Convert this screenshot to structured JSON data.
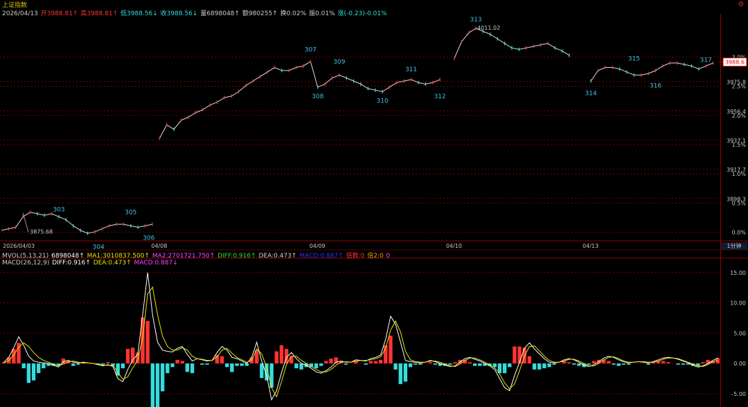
{
  "header": {
    "index_name": "上证指数",
    "date": "2026/04/13",
    "open": "开3988.81↑",
    "high": "高3988.81↑",
    "low": "低3988.56↓",
    "close": "收3988.56↓",
    "volume": "量6898048↑",
    "amount": "额980255↑",
    "turnover": "换0.02%",
    "amplitude": "振0.01%",
    "change": "涨(-0.23)-0.01%"
  },
  "mvol_line": {
    "label": "MVOL(5,13,21)",
    "vol": "6898048↑",
    "ma1": "MA1:3010837.500↑",
    "ma2": "MA2:2701721.750↑",
    "diff": "DIFF:0.916↑",
    "dea": "DEA:0.473↑",
    "macd_hidden": "MACD:0.887↑",
    "dir": "倍数:0",
    "dir2": "倍2:0",
    "zero": "0"
  },
  "macd_line": {
    "label": "MACD(26,12,9)",
    "diff": "DIFF:0.916↑",
    "dea": "DEA:0.473↑",
    "macd": "MACD:0.887↓"
  },
  "colors": {
    "up": "#ff3333",
    "down": "#33dddd",
    "grid": "#7a0000",
    "label_blue": "#3fc0e8",
    "axis_text": "#c8c8c8",
    "yellow": "#e8e800",
    "white": "#ffffff"
  },
  "current_price_tag": "3988.6",
  "time_unit_tag": "1分钟",
  "icons": {
    "settings": "gear-icon"
  },
  "chart_data": [
    {
      "type": "line",
      "name": "price",
      "x_labels": [
        "2026/04/03",
        "04/08",
        "04/09",
        "04/10",
        "04/13"
      ],
      "price_axis_ticks": [
        "3898.3",
        "3917.7",
        "3937.1",
        "3956.4",
        "3975.8",
        "3988.6"
      ],
      "percent_axis_ticks": [
        "0.0%",
        "0.5%",
        "1.0%",
        "1.5%",
        "2.0%",
        "2.5%",
        "3.0%"
      ],
      "annotations": [
        {
          "label": "303",
          "value": 3885
        },
        {
          "label": "304",
          "value": 3872
        },
        {
          "label": "305",
          "value": 3883
        },
        {
          "label": "306",
          "value": 3878
        },
        {
          "label": "307",
          "value": 3991
        },
        {
          "label": "308",
          "value": 3972
        },
        {
          "label": "309",
          "value": 3983
        },
        {
          "label": "310",
          "value": 3969
        },
        {
          "label": "311",
          "value": 3978
        },
        {
          "label": "312",
          "value": 3972
        },
        {
          "label": "313",
          "value": 4011
        },
        {
          "label": "314",
          "value": 3974
        },
        {
          "label": "315",
          "value": 3985
        },
        {
          "label": "316",
          "value": 3979
        },
        {
          "label": "317",
          "value": 3984
        }
      ],
      "price_labels": [
        {
          "label": "3875.68",
          "value": 3875.68
        },
        {
          "label": "4011.02",
          "value": 4011.02
        }
      ],
      "points": [
        [
          0,
          3877
        ],
        [
          2,
          3878
        ],
        [
          4,
          3879
        ],
        [
          6,
          3886
        ],
        [
          8,
          3889
        ],
        [
          10,
          3888
        ],
        [
          12,
          3887
        ],
        [
          14,
          3888
        ],
        [
          16,
          3886
        ],
        [
          18,
          3884
        ],
        [
          20,
          3880
        ],
        [
          22,
          3877
        ],
        [
          24,
          3875
        ],
        [
          26,
          3876
        ],
        [
          28,
          3878
        ],
        [
          30,
          3880
        ],
        [
          32,
          3881
        ],
        [
          34,
          3881
        ],
        [
          36,
          3880
        ],
        [
          38,
          3879
        ],
        [
          40,
          3880
        ],
        [
          42,
          3881
        ],
        [
          44,
          3938
        ],
        [
          46,
          3947
        ],
        [
          48,
          3944
        ],
        [
          50,
          3950
        ],
        [
          52,
          3952
        ],
        [
          54,
          3955
        ],
        [
          56,
          3957
        ],
        [
          58,
          3960
        ],
        [
          60,
          3962
        ],
        [
          62,
          3965
        ],
        [
          64,
          3966
        ],
        [
          66,
          3969
        ],
        [
          68,
          3973
        ],
        [
          70,
          3976
        ],
        [
          72,
          3979
        ],
        [
          74,
          3982
        ],
        [
          76,
          3985
        ],
        [
          78,
          3983
        ],
        [
          80,
          3983
        ],
        [
          82,
          3985
        ],
        [
          84,
          3986
        ],
        [
          86,
          3989
        ],
        [
          88,
          3972
        ],
        [
          90,
          3974
        ],
        [
          92,
          3978
        ],
        [
          94,
          3980
        ],
        [
          96,
          3978
        ],
        [
          98,
          3976
        ],
        [
          100,
          3974
        ],
        [
          102,
          3971
        ],
        [
          104,
          3970
        ],
        [
          106,
          3969
        ],
        [
          108,
          3972
        ],
        [
          110,
          3975
        ],
        [
          112,
          3976
        ],
        [
          114,
          3977
        ],
        [
          116,
          3975
        ],
        [
          118,
          3974
        ],
        [
          120,
          3975
        ],
        [
          122,
          3977
        ],
        [
          126,
          3991
        ],
        [
          128,
          4002
        ],
        [
          130,
          4008
        ],
        [
          132,
          4011
        ],
        [
          134,
          4009
        ],
        [
          136,
          4007
        ],
        [
          138,
          4004
        ],
        [
          140,
          4001
        ],
        [
          142,
          3998
        ],
        [
          144,
          3997
        ],
        [
          146,
          3998
        ],
        [
          148,
          3999
        ],
        [
          150,
          4000
        ],
        [
          152,
          4001
        ],
        [
          154,
          3998
        ],
        [
          156,
          3996
        ],
        [
          158,
          3993
        ],
        [
          164,
          3976
        ],
        [
          166,
          3983
        ],
        [
          168,
          3985
        ],
        [
          170,
          3985
        ],
        [
          172,
          3984
        ],
        [
          174,
          3982
        ],
        [
          176,
          3980
        ],
        [
          178,
          3980
        ],
        [
          180,
          3981
        ],
        [
          182,
          3983
        ],
        [
          184,
          3986
        ],
        [
          186,
          3988
        ],
        [
          188,
          3988
        ],
        [
          190,
          3987
        ],
        [
          192,
          3986
        ],
        [
          194,
          3984
        ],
        [
          196,
          3986
        ],
        [
          198,
          3988
        ]
      ]
    },
    {
      "type": "bar",
      "name": "MACD",
      "ylim": [
        -6.5,
        16
      ],
      "y_ticks": [
        "15.00",
        "10.00",
        "5.00",
        "0.00",
        "-5.00"
      ],
      "series": [
        {
          "name": "DIFF",
          "values": [
            0.2,
            1.0,
            2.6,
            4.4,
            3.0,
            1.2,
            0.4,
            0.2,
            0.1,
            0.0,
            -0.3,
            -0.6,
            0.3,
            0.5,
            0.2,
            0.1,
            0.2,
            0.1,
            0.0,
            -0.2,
            -0.4,
            -0.2,
            -0.5,
            -2.5,
            -3.0,
            -1.0,
            0.6,
            1.5,
            8.0,
            15.0,
            8.0,
            3.5,
            2.2,
            2.0,
            1.9,
            2.5,
            2.8,
            1.5,
            0.4,
            0.8,
            0.6,
            0.4,
            0.5,
            1.8,
            2.8,
            2.2,
            1.0,
            0.8,
            0.4,
            0.0,
            1.0,
            3.5,
            0.4,
            -2.0,
            -6.0,
            -4.5,
            -1.5,
            1.0,
            1.8,
            0.8,
            0.0,
            -0.3,
            -0.8,
            -1.4,
            -1.6,
            -1.2,
            -0.6,
            0.2,
            0.4,
            0.2,
            0.2,
            0.6,
            0.5,
            0.4,
            0.8,
            1.0,
            1.4,
            4.0,
            7.8,
            6.5,
            3.5,
            0.5,
            0.3,
            0.2,
            0.1,
            0.2,
            0.5,
            0.3,
            0.0,
            -0.3,
            -0.5,
            -0.4,
            0.2,
            0.8,
            1.0,
            0.7,
            0.4,
            0.0,
            -0.4,
            -1.0,
            -2.5,
            -4.0,
            -4.5,
            -2.0,
            0.2,
            2.5,
            3.4,
            2.4,
            1.6,
            0.8,
            0.2,
            0.1,
            0.2,
            0.6,
            0.8,
            0.6,
            0.2,
            -0.3,
            -0.5,
            -0.2,
            0.3,
            0.9,
            1.2,
            1.0,
            0.6,
            0.3,
            0.1,
            0.2,
            0.3,
            0.2,
            0.1,
            0.3,
            0.6,
            0.9,
            1.0,
            0.9,
            0.7,
            0.4,
            0.1,
            -0.3,
            -0.6,
            -0.4,
            0.0,
            0.5,
            0.9
          ]
        },
        {
          "name": "DEA",
          "values": [
            0.1,
            0.5,
            1.4,
            2.7,
            3.4,
            2.8,
            1.8,
            1.0,
            0.5,
            0.2,
            -0.1,
            -0.4,
            -0.1,
            0.3,
            0.4,
            0.2,
            0.1,
            0.1,
            0.0,
            -0.1,
            -0.3,
            -0.3,
            -0.3,
            -1.5,
            -2.6,
            -2.2,
            -0.7,
            0.6,
            4.2,
            11.5,
            12.6,
            8.0,
            4.5,
            2.8,
            2.2,
            2.2,
            2.6,
            2.2,
            1.2,
            0.8,
            0.7,
            0.5,
            0.5,
            1.1,
            2.2,
            2.5,
            1.7,
            1.0,
            0.6,
            0.2,
            0.5,
            2.4,
            1.6,
            -0.6,
            -4.0,
            -5.5,
            -3.0,
            -0.2,
            1.2,
            1.2,
            0.5,
            0.0,
            -0.5,
            -1.0,
            -1.4,
            -1.4,
            -1.0,
            -0.3,
            0.2,
            0.3,
            0.2,
            0.4,
            0.5,
            0.5,
            0.6,
            0.8,
            1.1,
            2.5,
            5.5,
            7.0,
            5.2,
            2.0,
            0.6,
            0.3,
            0.2,
            0.2,
            0.4,
            0.4,
            0.2,
            -0.1,
            -0.4,
            -0.5,
            -0.1,
            0.5,
            0.9,
            0.9,
            0.6,
            0.2,
            -0.2,
            -0.7,
            -1.7,
            -3.2,
            -4.2,
            -3.4,
            -1.2,
            1.2,
            2.8,
            2.9,
            2.1,
            1.2,
            0.5,
            0.2,
            0.2,
            0.4,
            0.7,
            0.7,
            0.4,
            0.0,
            -0.4,
            -0.4,
            0.0,
            0.6,
            1.0,
            1.1,
            0.8,
            0.4,
            0.2,
            0.2,
            0.3,
            0.3,
            0.2,
            0.2,
            0.4,
            0.7,
            0.9,
            0.9,
            0.8,
            0.5,
            0.2,
            -0.1,
            -0.4,
            -0.5,
            -0.2,
            0.3,
            0.5
          ]
        },
        {
          "name": "MACD",
          "values": [
            0.2,
            1.0,
            2.4,
            3.4,
            -0.8,
            -3.2,
            -2.8,
            -1.6,
            -0.8,
            -0.4,
            -0.4,
            -0.4,
            0.8,
            0.4,
            -0.4,
            -0.2,
            0.2,
            0.0,
            0.0,
            -0.2,
            -0.2,
            0.2,
            -0.4,
            -2.0,
            -0.8,
            2.4,
            2.6,
            1.8,
            7.6,
            7.0,
            -9.2,
            -9.0,
            -4.6,
            -1.6,
            -0.6,
            0.6,
            0.4,
            -1.4,
            -1.6,
            0.0,
            -0.2,
            -0.2,
            0.0,
            1.4,
            1.2,
            -0.6,
            -1.4,
            -0.4,
            -0.4,
            -0.4,
            1.0,
            2.2,
            -2.4,
            -2.8,
            -4.0,
            2.0,
            3.0,
            2.4,
            1.2,
            -0.8,
            -1.0,
            -0.6,
            -0.6,
            -0.8,
            -0.4,
            0.4,
            0.8,
            1.0,
            0.4,
            -0.2,
            0.0,
            0.4,
            0.0,
            -0.2,
            0.4,
            0.4,
            0.6,
            3.0,
            4.6,
            -1.0,
            -3.4,
            -3.0,
            -0.6,
            -0.2,
            -0.2,
            0.0,
            0.2,
            -0.2,
            -0.4,
            -0.4,
            -0.2,
            0.2,
            0.6,
            0.6,
            0.2,
            -0.4,
            -0.4,
            -0.4,
            -0.4,
            -0.6,
            -1.6,
            -1.6,
            -0.6,
            2.8,
            2.8,
            2.6,
            1.2,
            -1.0,
            -1.0,
            -0.8,
            -0.6,
            -0.2,
            0.0,
            0.4,
            0.2,
            -0.2,
            -0.4,
            -0.6,
            -0.2,
            0.4,
            0.6,
            0.6,
            0.4,
            -0.2,
            -0.4,
            -0.2,
            -0.2,
            0.0,
            0.0,
            0.0,
            -0.2,
            0.2,
            0.4,
            0.4,
            0.2,
            0.0,
            -0.2,
            -0.2,
            -0.2,
            -0.4,
            -0.4,
            0.2,
            0.6,
            0.4,
            0.9
          ]
        }
      ]
    }
  ]
}
